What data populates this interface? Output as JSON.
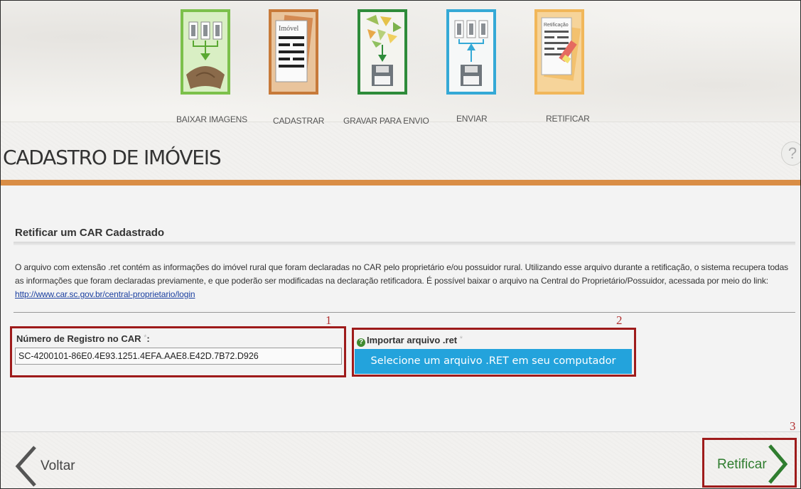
{
  "steps": [
    {
      "label": "BAIXAR IMAGENS",
      "icon": "download-images-icon",
      "color": "#7cc04b"
    },
    {
      "label": "CADASTRAR",
      "icon": "property-form-icon",
      "color": "#c77a3a",
      "doc_label": "Imóvel"
    },
    {
      "label": "GRAVAR PARA ENVIO",
      "icon": "save-disk-icon",
      "color": "#2e8b3a"
    },
    {
      "label": "ENVIAR",
      "icon": "upload-icon",
      "color": "#35a9d6"
    },
    {
      "label": "RETIFICAR",
      "icon": "rectify-document-icon",
      "color": "#f1b75a",
      "doc_label": "Retificação"
    }
  ],
  "page": {
    "title": "CADASTRO DE IMÓVEIS",
    "help": "?"
  },
  "section": {
    "title": "Retificar um CAR Cadastrado",
    "description_text": "O arquivo com extensão .ret contém as informações do imóvel rural que foram declaradas no CAR pelo proprietário e/ou possuidor rural. Utilizando esse arquivo durante a retificação, o sistema recupera todas as informações que foram declaradas previamente, e que poderão ser modificadas na declaração retificadora. É possível baixar o arquivo na Central do Proprietário/Possuidor, acessada por meio do link: ",
    "link": "http://www.car.sc.gov.br/central-proprietario/login"
  },
  "form": {
    "car_label": "Número de Registro no CAR",
    "required_mark": "*",
    "car_suffix": ":",
    "car_value": "SC-4200101-86E0.4E93.1251.4EFA.AAE8.E42D.7B72.D926",
    "import_icon": "?",
    "import_label": "Importar arquivo .ret",
    "select_button": "Selecione um arquivo .RET em seu computador"
  },
  "callouts": [
    "1",
    "2",
    "3"
  ],
  "nav": {
    "back": "Voltar",
    "next": "Retificar"
  },
  "colors": {
    "accent_orange": "#d98d45",
    "callout_red": "#9e1b1b",
    "button_blue": "#23a3dc",
    "next_green": "#2f7d2f"
  }
}
